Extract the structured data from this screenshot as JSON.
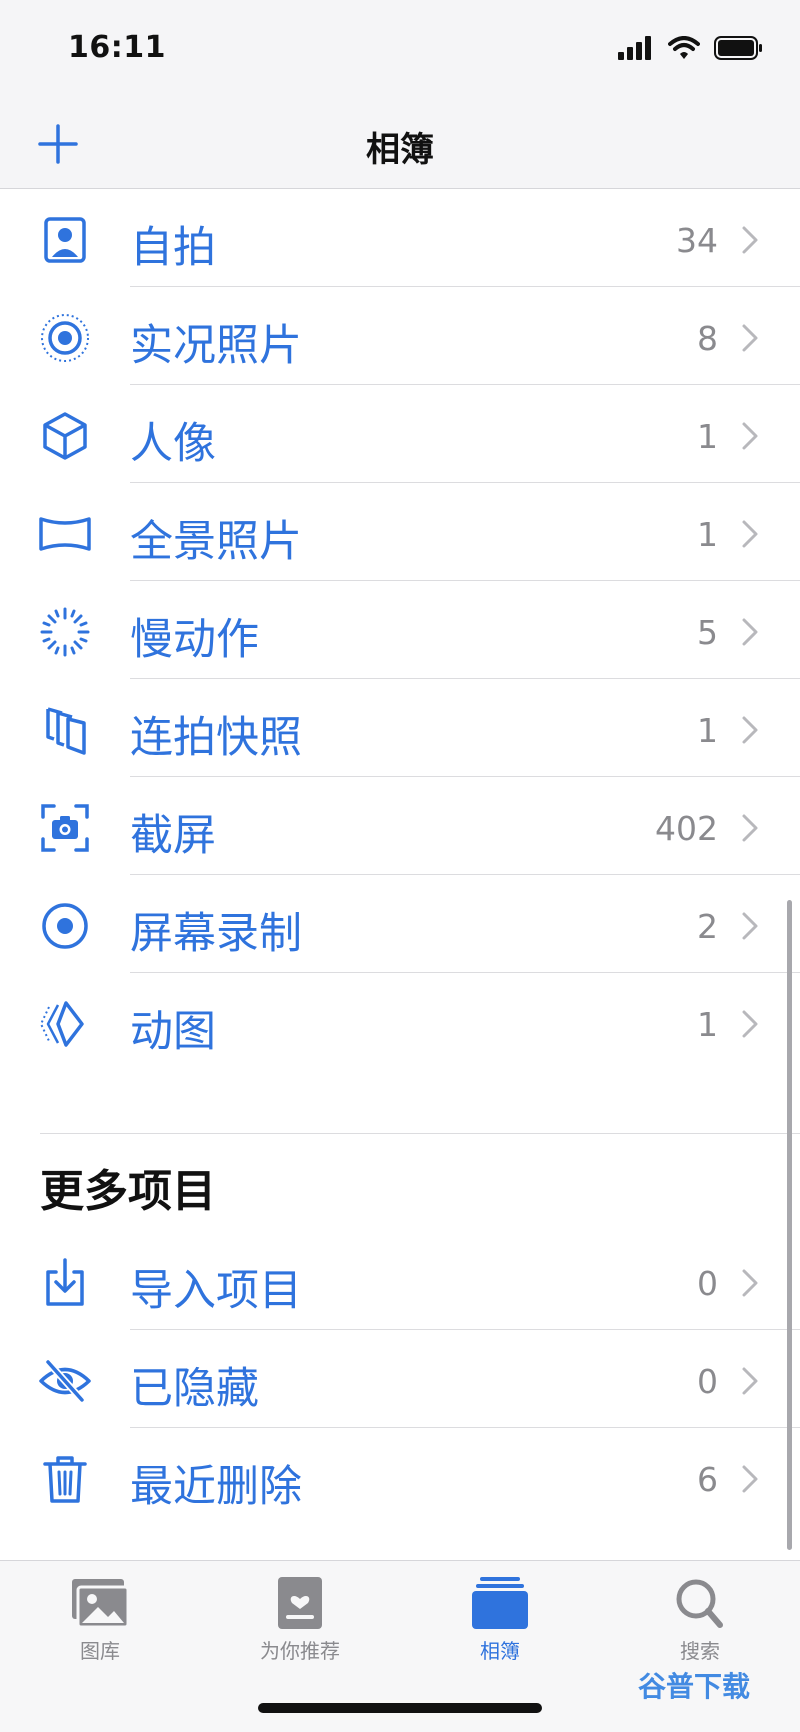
{
  "status_bar": {
    "time": "16:11"
  },
  "nav": {
    "title": "相簿"
  },
  "media_types": [
    {
      "label": "自拍",
      "count": "34",
      "icon": "selfie-icon"
    },
    {
      "label": "实况照片",
      "count": "8",
      "icon": "live-photo-icon"
    },
    {
      "label": "人像",
      "count": "1",
      "icon": "portrait-cube-icon"
    },
    {
      "label": "全景照片",
      "count": "1",
      "icon": "panorama-icon"
    },
    {
      "label": "慢动作",
      "count": "5",
      "icon": "slow-motion-icon"
    },
    {
      "label": "连拍快照",
      "count": "1",
      "icon": "burst-icon"
    },
    {
      "label": "截屏",
      "count": "402",
      "icon": "screenshot-icon"
    },
    {
      "label": "屏幕录制",
      "count": "2",
      "icon": "screen-recording-icon"
    },
    {
      "label": "动图",
      "count": "1",
      "icon": "animated-icon"
    }
  ],
  "more": {
    "title": "更多项目",
    "items": [
      {
        "label": "导入项目",
        "count": "0",
        "icon": "import-icon"
      },
      {
        "label": "已隐藏",
        "count": "0",
        "icon": "hidden-eye-icon"
      },
      {
        "label": "最近删除",
        "count": "6",
        "icon": "trash-icon"
      }
    ]
  },
  "tabs": [
    {
      "label": "图库",
      "icon": "photos-library-icon",
      "active": false
    },
    {
      "label": "为你推荐",
      "icon": "for-you-icon",
      "active": false
    },
    {
      "label": "相簿",
      "icon": "albums-icon",
      "active": true
    },
    {
      "label": "搜索",
      "icon": "search-icon",
      "active": false
    }
  ],
  "watermark": "谷普下载",
  "colors": {
    "accent": "#2f73dd",
    "secondary_text": "#8a8a8e",
    "bar_bg": "#f5f5f7"
  }
}
